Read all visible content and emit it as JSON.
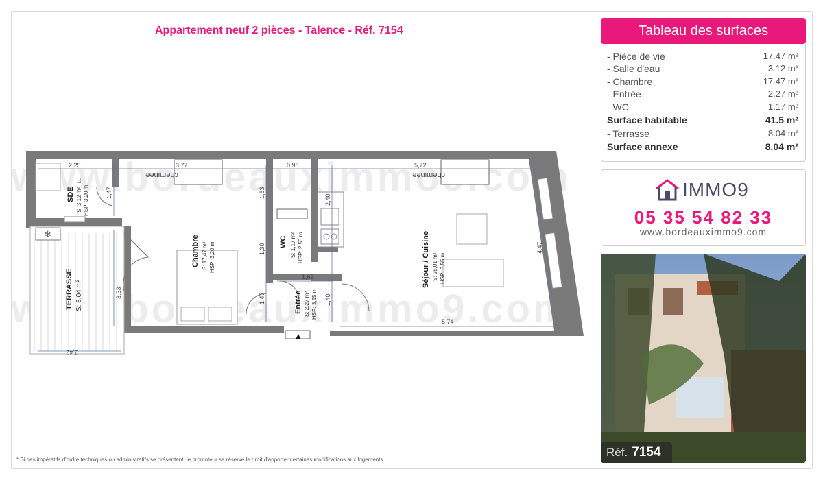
{
  "plan": {
    "title": "Appartement neuf 2 pièces - Talence - Réf. 7154",
    "watermark": "www.bordeauximmo9.com",
    "rooms": {
      "sde": {
        "name": "SDE",
        "surface": "S: 3,12 m²",
        "hsp": "HSP: 3,20 m"
      },
      "chambre": {
        "name": "Chambre",
        "surface": "S: 17,47 m²",
        "hsp": "HSP: 3,20 m"
      },
      "wc": {
        "name": "WC",
        "surface": "S: 1,17 m²",
        "hsp": "HSP: 2,50 m"
      },
      "entree": {
        "name": "Entrée",
        "surface": "S: 2,27 m²",
        "hsp": "HSP: 3,55 m"
      },
      "sejour": {
        "name": "Séjour / Cuisine",
        "surface": "S: 25,01 m²",
        "hsp": "HSP: 3,55 m"
      },
      "terrasse": {
        "name": "TERRASSE",
        "surface": "S: 8,04 m²"
      }
    },
    "fixtures": {
      "cheminee": "cheminée",
      "ll": "LL"
    },
    "dimensions": {
      "d225": "2,25",
      "d377": "3,77",
      "d098": "0,98",
      "d572": "5,72",
      "d147a": "1,47",
      "d163": "1,63",
      "d240": "2,40",
      "d130": "1,30",
      "d162": "1,62",
      "d147b": "1,47",
      "d140": "1,40",
      "d333": "3,33",
      "d447": "4,47",
      "d574": "5,74",
      "d242": "2,42"
    },
    "footnote": "* Si des impératifs d'ordre techniques ou administratifs se présentent, le promoteur se réserve le droit d'apporter certaines modifications aux logements."
  },
  "surfaces": {
    "header": "Tableau des surfaces",
    "rows": [
      {
        "label": "- Pièce de vie",
        "value": "17.47 m²",
        "bold": false
      },
      {
        "label": "- Salle d'eau",
        "value": "3.12 m²",
        "bold": false
      },
      {
        "label": "- Chambre",
        "value": "17.47 m²",
        "bold": false
      },
      {
        "label": "- Entrée",
        "value": "2.27 m²",
        "bold": false
      },
      {
        "label": "- WC",
        "value": "1.17 m²",
        "bold": false
      },
      {
        "label": "Surface habitable",
        "value": "41.5 m²",
        "bold": true
      },
      {
        "label": "- Terrasse",
        "value": "8.04 m²",
        "bold": false
      },
      {
        "label": "Surface annexe",
        "value": "8.04 m²",
        "bold": true
      }
    ]
  },
  "contact": {
    "logo_text": "IMMO9",
    "phone": "05 35 54 82 33",
    "website": "www.bordeauximmo9.com"
  },
  "photo": {
    "ref_label": "Réf.",
    "ref_number": "7154"
  },
  "colors": {
    "accent": "#e8197a",
    "wall": "#7a7a7a",
    "dimension": "#5a78a0",
    "logo": "#4b4b6b"
  }
}
